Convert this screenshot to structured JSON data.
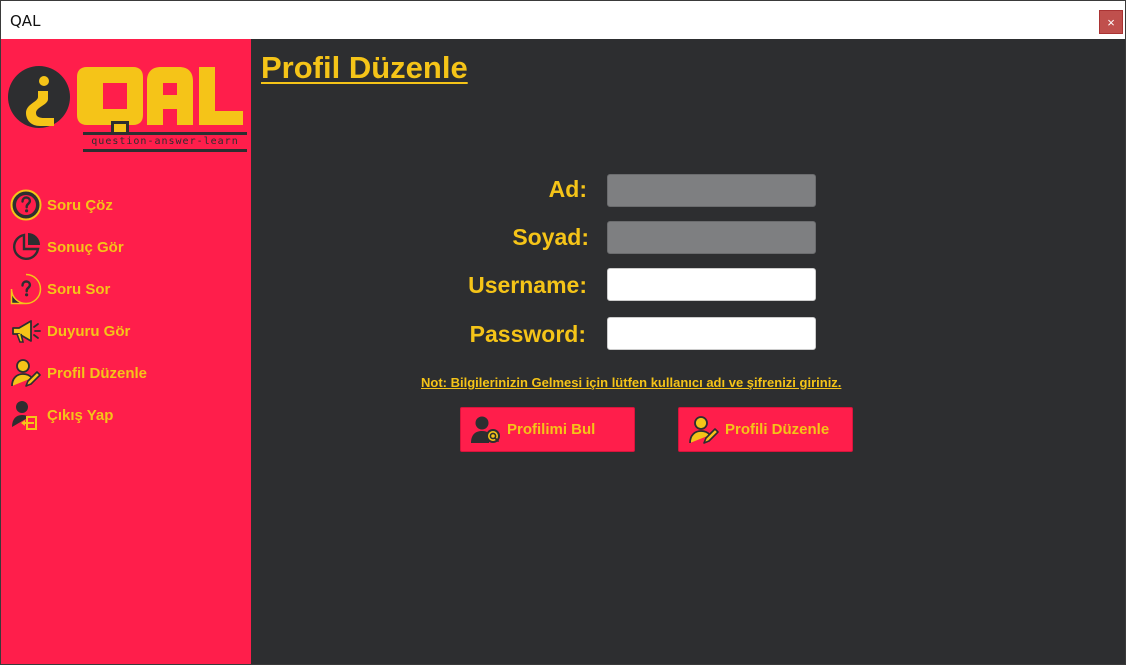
{
  "window": {
    "title": "QAL",
    "close_label": "×"
  },
  "logo": {
    "text": "QAL",
    "tagline": "question-answer-learn"
  },
  "sidebar": {
    "items": [
      {
        "label": "Soru Çöz",
        "icon": "question-icon"
      },
      {
        "label": "Sonuç Gör",
        "icon": "pie-chart-icon"
      },
      {
        "label": "Soru Sor",
        "icon": "question-icon"
      },
      {
        "label": "Duyuru Gör",
        "icon": "megaphone-icon"
      },
      {
        "label": "Profil Düzenle",
        "icon": "user-edit-icon"
      },
      {
        "label": "Çıkış Yap",
        "icon": "logout-icon"
      }
    ]
  },
  "main": {
    "title": "Profil Düzenle",
    "form": {
      "ad_label": "Ad:",
      "ad_value": "",
      "soyad_label": "Soyad:",
      "soyad_value": "",
      "username_label": "Username:",
      "username_value": "",
      "password_label": "Password:",
      "password_value": ""
    },
    "note": "Not: Bilgilerinizin Gelmesi için lütfen kullanıcı adı ve şifrenizi giriniz.",
    "buttons": {
      "find_label": "Profilimi Bul",
      "edit_label": "Profili Düzenle"
    }
  },
  "colors": {
    "sidebar_bg": "#ff1e4b",
    "main_bg": "#2d2e30",
    "accent": "#f5c418"
  }
}
